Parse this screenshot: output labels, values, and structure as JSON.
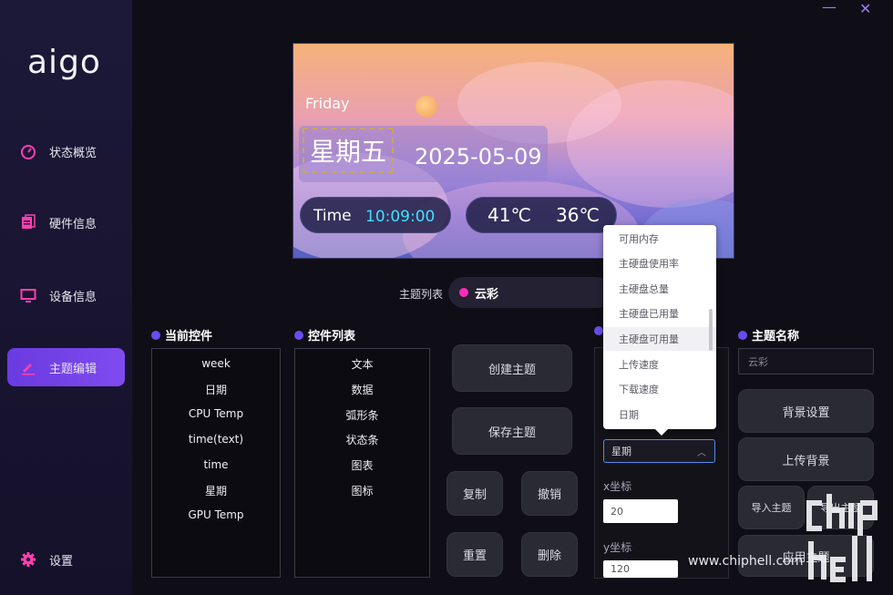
{
  "app": {
    "logo": "aigo",
    "minimize": "—",
    "close": "✕"
  },
  "sidebar": {
    "items": [
      {
        "label": "状态概览",
        "icon": "dashboard-icon"
      },
      {
        "label": "硬件信息",
        "icon": "hardware-icon"
      },
      {
        "label": "设备信息",
        "icon": "monitor-icon"
      },
      {
        "label": "主题编辑",
        "icon": "edit-icon",
        "active": true
      },
      {
        "label": "设置",
        "icon": "gear-icon"
      }
    ]
  },
  "preview": {
    "day_en": "Friday",
    "weekday": "星期五",
    "date": "2025-05-09",
    "time_label": "Time",
    "time_value": "10:09:00",
    "temp1": "41℃",
    "temp2": "36℃"
  },
  "theme_list": {
    "label": "主题列表",
    "selected": "云彩"
  },
  "current_widgets": {
    "title": "当前控件",
    "items": [
      "week",
      "日期",
      "CPU Temp",
      "time(text)",
      "time",
      "星期",
      "GPU Temp"
    ]
  },
  "widget_list": {
    "title": "控件列表",
    "items": [
      "文本",
      "数据",
      "弧形条",
      "状态条",
      "图表",
      "图标"
    ]
  },
  "actions": {
    "create": "创建主题",
    "save": "保存主题",
    "copy": "复制",
    "undo": "撤销",
    "reset": "重置",
    "delete": "删除"
  },
  "properties": {
    "selected": "星期",
    "x_label": "x坐标",
    "x_value": "20",
    "y_label": "y坐标",
    "y_value": "120",
    "dropdown": [
      "可用内存",
      "主硬盘使用率",
      "主硬盘总量",
      "主硬盘已用量",
      "主硬盘可用量",
      "上传速度",
      "下载速度",
      "日期"
    ]
  },
  "theme_name": {
    "title": "主题名称",
    "placeholder": "云彩",
    "bg_settings": "背景设置",
    "upload_bg": "上传背景",
    "import_theme": "导入主题",
    "export_theme": "导出主题",
    "apply_theme": "应用主题"
  },
  "watermark": {
    "url": "www.chiphell.com"
  },
  "colors": {
    "accent": "#6a4cf0",
    "active_nav": "#7343e8",
    "highlight": "#3fe0ff",
    "theme_dot": "#ff2bb8"
  }
}
